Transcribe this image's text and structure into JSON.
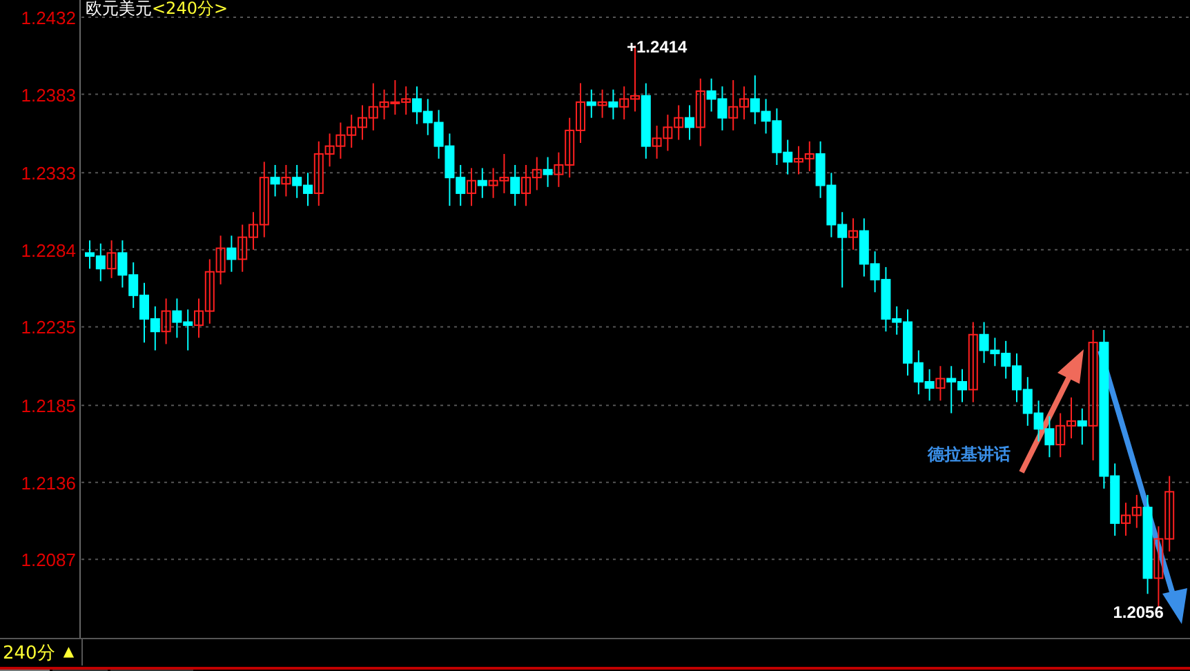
{
  "title": {
    "instrument": "欧元美元",
    "period": "<240分>"
  },
  "chart": {
    "chart_data": {
      "type": "candlestick",
      "ylim": [
        1.2037,
        1.2443
      ],
      "yticks": [
        1.2432,
        1.2383,
        1.2333,
        1.2284,
        1.2235,
        1.2185,
        1.2136,
        1.2087
      ],
      "ohlc": [
        [
          1.2282,
          1.229,
          1.2272,
          1.228
        ],
        [
          1.228,
          1.2288,
          1.2264,
          1.2272
        ],
        [
          1.2272,
          1.229,
          1.2266,
          1.2282
        ],
        [
          1.2282,
          1.229,
          1.226,
          1.2268
        ],
        [
          1.2268,
          1.2276,
          1.2247,
          1.2255
        ],
        [
          1.2255,
          1.2263,
          1.2225,
          1.224
        ],
        [
          1.224,
          1.2248,
          1.222,
          1.2232
        ],
        [
          1.2232,
          1.2253,
          1.2224,
          1.2245
        ],
        [
          1.2245,
          1.2253,
          1.2228,
          1.2238
        ],
        [
          1.2238,
          1.2246,
          1.222,
          1.2236
        ],
        [
          1.2236,
          1.2253,
          1.2228,
          1.2245
        ],
        [
          1.2245,
          1.2278,
          1.2237,
          1.227
        ],
        [
          1.227,
          1.2293,
          1.2262,
          1.2285
        ],
        [
          1.2285,
          1.2293,
          1.227,
          1.2278
        ],
        [
          1.2278,
          1.23,
          1.227,
          1.2292
        ],
        [
          1.2292,
          1.2308,
          1.2284,
          1.23
        ],
        [
          1.23,
          1.234,
          1.2292,
          1.233
        ],
        [
          1.233,
          1.2338,
          1.2318,
          1.2326
        ],
        [
          1.2326,
          1.2338,
          1.2318,
          1.233
        ],
        [
          1.233,
          1.2338,
          1.2317,
          1.2325
        ],
        [
          1.2325,
          1.2333,
          1.2312,
          1.232
        ],
        [
          1.232,
          1.2353,
          1.2312,
          1.2345
        ],
        [
          1.2345,
          1.2358,
          1.2337,
          1.235
        ],
        [
          1.235,
          1.2365,
          1.2342,
          1.2357
        ],
        [
          1.2357,
          1.237,
          1.2349,
          1.2362
        ],
        [
          1.2362,
          1.2376,
          1.2354,
          1.2368
        ],
        [
          1.2368,
          1.239,
          1.236,
          1.2375
        ],
        [
          1.2375,
          1.2386,
          1.2367,
          1.2378
        ],
        [
          1.2378,
          1.2392,
          1.237,
          1.2378
        ],
        [
          1.2378,
          1.2388,
          1.237,
          1.238
        ],
        [
          1.238,
          1.2388,
          1.2364,
          1.2372
        ],
        [
          1.2372,
          1.238,
          1.2357,
          1.2365
        ],
        [
          1.2365,
          1.2373,
          1.2342,
          1.235
        ],
        [
          1.235,
          1.2358,
          1.2312,
          1.233
        ],
        [
          1.233,
          1.2338,
          1.2312,
          1.232
        ],
        [
          1.232,
          1.2336,
          1.2312,
          1.2328
        ],
        [
          1.2328,
          1.2336,
          1.2317,
          1.2325
        ],
        [
          1.2325,
          1.2336,
          1.2317,
          1.2328
        ],
        [
          1.2328,
          1.2345,
          1.232,
          1.233
        ],
        [
          1.233,
          1.2338,
          1.2312,
          1.232
        ],
        [
          1.232,
          1.2338,
          1.2312,
          1.233
        ],
        [
          1.233,
          1.2343,
          1.2322,
          1.2335
        ],
        [
          1.2335,
          1.2343,
          1.2324,
          1.2332
        ],
        [
          1.2332,
          1.2346,
          1.2324,
          1.2338
        ],
        [
          1.2338,
          1.2368,
          1.233,
          1.236
        ],
        [
          1.236,
          1.239,
          1.2352,
          1.2378
        ],
        [
          1.2378,
          1.2386,
          1.2368,
          1.2376
        ],
        [
          1.2376,
          1.2386,
          1.2368,
          1.2378
        ],
        [
          1.2378,
          1.2386,
          1.2367,
          1.2375
        ],
        [
          1.2375,
          1.2388,
          1.2367,
          1.238
        ],
        [
          1.238,
          1.2414,
          1.2372,
          1.2382
        ],
        [
          1.2382,
          1.239,
          1.2342,
          1.235
        ],
        [
          1.235,
          1.2363,
          1.2342,
          1.2355
        ],
        [
          1.2355,
          1.237,
          1.2347,
          1.2362
        ],
        [
          1.2362,
          1.2376,
          1.2354,
          1.2368
        ],
        [
          1.2368,
          1.2376,
          1.2354,
          1.2362
        ],
        [
          1.2362,
          1.2393,
          1.235,
          1.2385
        ],
        [
          1.2385,
          1.2393,
          1.2372,
          1.238
        ],
        [
          1.238,
          1.2388,
          1.236,
          1.2368
        ],
        [
          1.2368,
          1.2392,
          1.236,
          1.2375
        ],
        [
          1.2375,
          1.2388,
          1.2367,
          1.238
        ],
        [
          1.238,
          1.2395,
          1.2364,
          1.2372
        ],
        [
          1.2372,
          1.238,
          1.2358,
          1.2366
        ],
        [
          1.2366,
          1.2374,
          1.2338,
          1.2346
        ],
        [
          1.2346,
          1.2354,
          1.2332,
          1.234
        ],
        [
          1.234,
          1.235,
          1.2332,
          1.2342
        ],
        [
          1.2342,
          1.2353,
          1.2334,
          1.2345
        ],
        [
          1.2345,
          1.2353,
          1.2317,
          1.2325
        ],
        [
          1.2325,
          1.2333,
          1.2292,
          1.23
        ],
        [
          1.23,
          1.2308,
          1.226,
          1.2292
        ],
        [
          1.2292,
          1.2304,
          1.2284,
          1.2296
        ],
        [
          1.2296,
          1.2304,
          1.2267,
          1.2275
        ],
        [
          1.2275,
          1.2283,
          1.2257,
          1.2265
        ],
        [
          1.2265,
          1.2273,
          1.2232,
          1.224
        ],
        [
          1.224,
          1.2248,
          1.223,
          1.2238
        ],
        [
          1.2238,
          1.2246,
          1.2204,
          1.2212
        ],
        [
          1.2212,
          1.222,
          1.2192,
          1.22
        ],
        [
          1.22,
          1.2208,
          1.2188,
          1.2196
        ],
        [
          1.2196,
          1.221,
          1.2188,
          1.2202
        ],
        [
          1.2202,
          1.221,
          1.218,
          1.22
        ],
        [
          1.22,
          1.2208,
          1.2187,
          1.2195
        ],
        [
          1.2195,
          1.2238,
          1.2187,
          1.223
        ],
        [
          1.223,
          1.2238,
          1.2212,
          1.222
        ],
        [
          1.222,
          1.2228,
          1.221,
          1.2218
        ],
        [
          1.2218,
          1.2226,
          1.2202,
          1.221
        ],
        [
          1.221,
          1.2218,
          1.2187,
          1.2195
        ],
        [
          1.2195,
          1.2203,
          1.2172,
          1.218
        ],
        [
          1.218,
          1.2188,
          1.2162,
          1.217
        ],
        [
          1.217,
          1.2178,
          1.2152,
          1.216
        ],
        [
          1.216,
          1.218,
          1.2152,
          1.2172
        ],
        [
          1.2172,
          1.219,
          1.2164,
          1.2175
        ],
        [
          1.2175,
          1.2183,
          1.216,
          1.2172
        ],
        [
          1.2172,
          1.2233,
          1.215,
          1.2225
        ],
        [
          1.2225,
          1.2233,
          1.2132,
          1.214
        ],
        [
          1.214,
          1.2148,
          1.2102,
          1.211
        ],
        [
          1.211,
          1.2123,
          1.2102,
          1.2115
        ],
        [
          1.2115,
          1.2128,
          1.2107,
          1.212
        ],
        [
          1.212,
          1.2128,
          1.2065,
          1.2075
        ],
        [
          1.2075,
          1.2108,
          1.2056,
          1.21
        ],
        [
          1.21,
          1.214,
          1.2092,
          1.213
        ]
      ],
      "grid": true,
      "annotations": [
        "+1.2414",
        "1.2056"
      ]
    },
    "event_note": {
      "text": "德拉基讲话"
    }
  },
  "footer": {
    "period": "240分",
    "marker": "▲"
  }
}
